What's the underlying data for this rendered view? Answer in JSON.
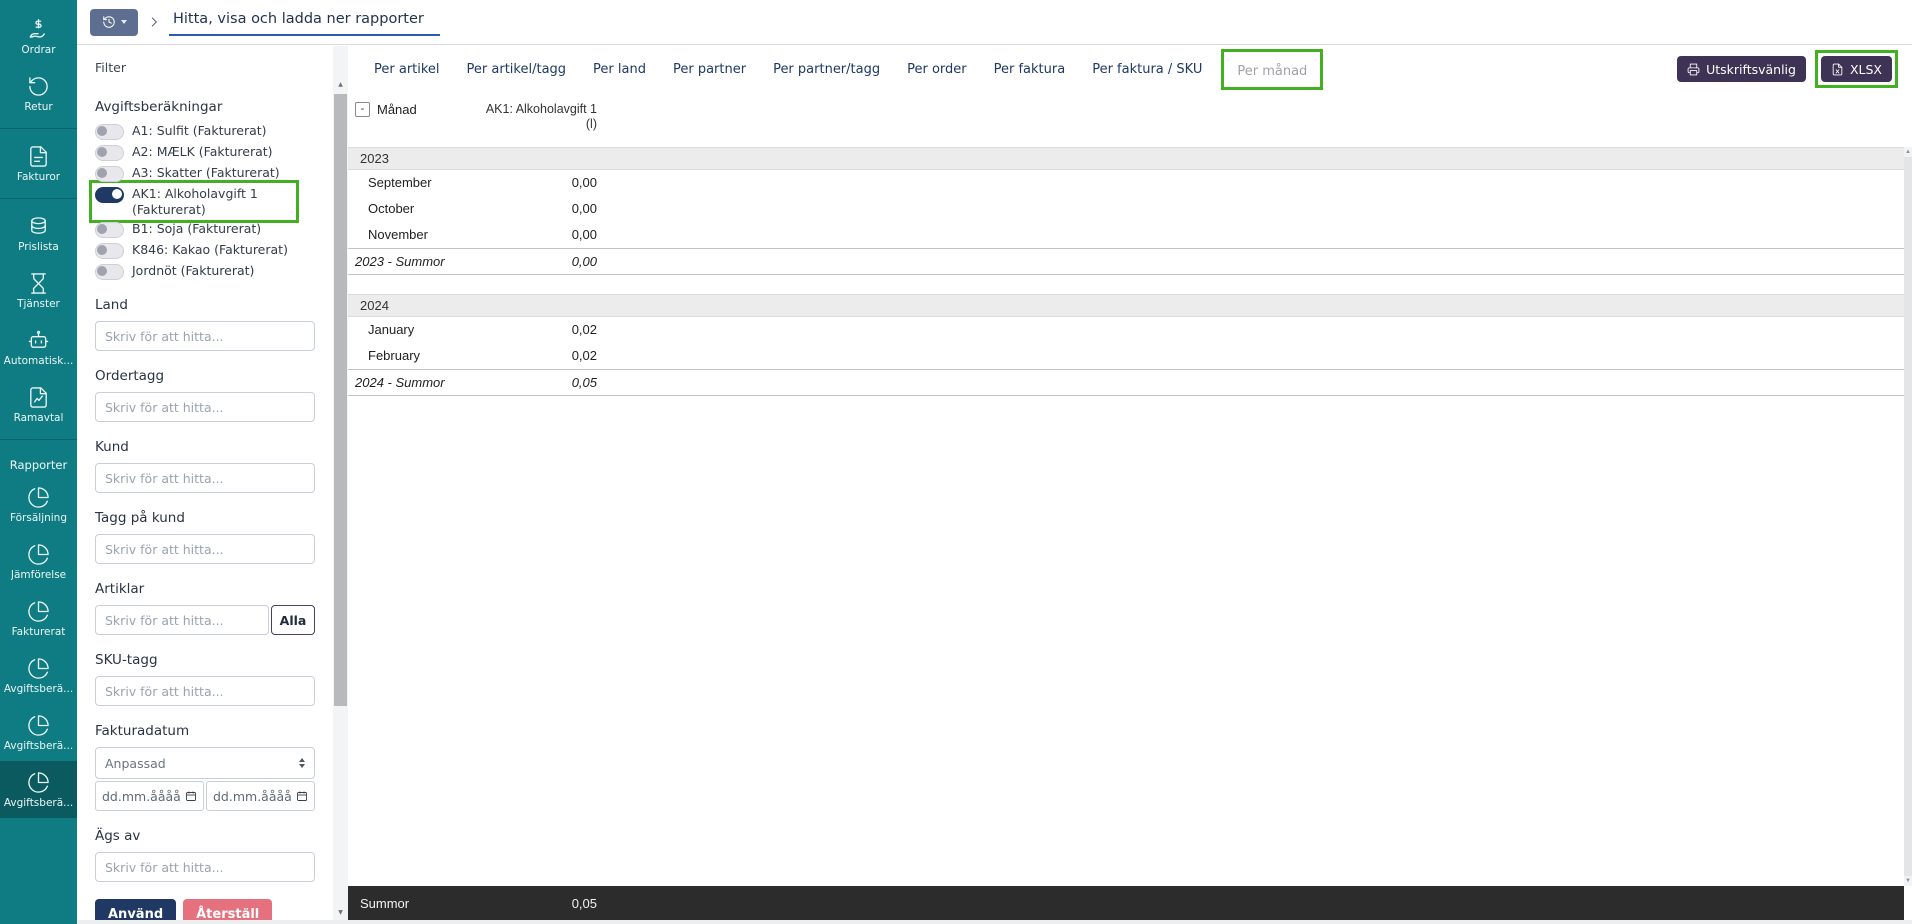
{
  "colors": {
    "sidebar-teal": "#0e7c82",
    "sidebar-active": "#0b5a60",
    "sidebar-divider": "#0a656b",
    "navy": "#1f3864",
    "accent-green": "#43b023",
    "btn-purple": "#3e3355",
    "btn-danger": "#e4717d",
    "history-btn": "#5d6e90",
    "footer-dark": "#2c2c2c",
    "group-row-bg": "#ececec",
    "underline-blue": "#2a5caa"
  },
  "sidebar": {
    "section_label": "Rapporter",
    "items": [
      {
        "label": "Ordrar",
        "icon": "hand-dollar-icon"
      },
      {
        "label": "Retur",
        "icon": "undo-icon"
      },
      {
        "label": "Fakturor",
        "icon": "invoice-icon"
      },
      {
        "label": "Prislista",
        "icon": "coins-icon"
      },
      {
        "label": "Tjänster",
        "icon": "hourglass-icon"
      },
      {
        "label": "Automatisk...",
        "icon": "robot-icon"
      },
      {
        "label": "Ramavtal",
        "icon": "file-chart-icon"
      },
      {
        "label": "Försäljning",
        "icon": "pie-chart-icon"
      },
      {
        "label": "Jämförelse",
        "icon": "pie-chart-icon"
      },
      {
        "label": "Fakturerat",
        "icon": "pie-chart-icon"
      },
      {
        "label": "Avgiftsberä...",
        "icon": "pie-chart-icon"
      },
      {
        "label": "Avgiftsberä...",
        "icon": "pie-chart-icon"
      },
      {
        "label": "Avgiftsberä...",
        "icon": "pie-chart-icon",
        "active": true
      }
    ]
  },
  "topbar": {
    "breadcrumb": "Hitta, visa och ladda ner rapporter"
  },
  "filter": {
    "title": "Filter",
    "charges_heading": "Avgiftsberäkningar",
    "toggles": [
      {
        "label": "A1: Sulfit (Fakturerat)",
        "on": false
      },
      {
        "label": "A2: MÆLK (Fakturerat)",
        "on": false
      },
      {
        "label": "A3: Skatter (Fakturerat)",
        "on": false
      },
      {
        "label": "AK1: Alkoholavgift 1 (Fakturerat)",
        "on": true,
        "highlighted": true
      },
      {
        "label": "B1: Soja (Fakturerat)",
        "on": false
      },
      {
        "label": "K846: Kakao (Fakturerat)",
        "on": false
      },
      {
        "label": "Jordnöt (Fakturerat)",
        "on": false
      }
    ],
    "search_placeholder": "Skriv för att hitta...",
    "labels": {
      "land": "Land",
      "ordertagg": "Ordertagg",
      "kund": "Kund",
      "tagg_pa_kund": "Tagg på kund",
      "artiklar": "Artiklar",
      "sku_tagg": "SKU-tagg",
      "fakturadatum": "Fakturadatum",
      "ags_av": "Ägs av"
    },
    "alla_button": "Alla",
    "date_preset_value": "Anpassad",
    "date_placeholder": "dd.mm.åååå",
    "apply_button": "Använd",
    "reset_button": "Återställ"
  },
  "tabs": [
    {
      "label": "Per artikel"
    },
    {
      "label": "Per artikel/tagg"
    },
    {
      "label": "Per land"
    },
    {
      "label": "Per partner"
    },
    {
      "label": "Per partner/tagg"
    },
    {
      "label": "Per order"
    },
    {
      "label": "Per faktura"
    },
    {
      "label": "Per faktura / SKU"
    },
    {
      "label": "Per månad",
      "active": true,
      "highlighted": true
    }
  ],
  "actions": {
    "print_button": "Utskriftsvänlig",
    "xlsx_button": "XLSX"
  },
  "table": {
    "collapse_toggle": "-",
    "month_column": "Månad",
    "value_column": "AK1: Alkoholavgift 1 (l)",
    "groups": [
      {
        "year": "2023",
        "rows": [
          {
            "month": "September",
            "value": "0,00"
          },
          {
            "month": "October",
            "value": "0,00"
          },
          {
            "month": "November",
            "value": "0,00"
          }
        ],
        "sum_label": "2023 - Summor",
        "sum_value": "0,00"
      },
      {
        "year": "2024",
        "rows": [
          {
            "month": "January",
            "value": "0,02"
          },
          {
            "month": "February",
            "value": "0,02"
          }
        ],
        "sum_label": "2024 - Summor",
        "sum_value": "0,05"
      }
    ],
    "footer": {
      "label": "Summor",
      "value": "0,05"
    }
  }
}
